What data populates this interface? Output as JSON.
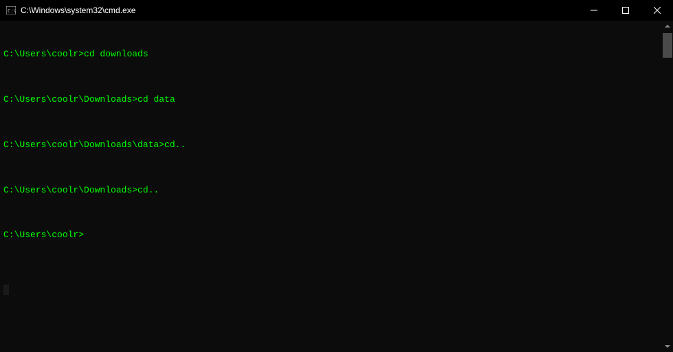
{
  "titlebar": {
    "title": "C:\\Windows\\system32\\cmd.exe"
  },
  "terminal": {
    "lines": [
      {
        "prompt": "C:\\Users\\coolr>",
        "command": "cd downloads"
      },
      {
        "prompt": "C:\\Users\\coolr\\Downloads>",
        "command": "cd data"
      },
      {
        "prompt": "C:\\Users\\coolr\\Downloads\\data>",
        "command": "cd.."
      },
      {
        "prompt": "C:\\Users\\coolr\\Downloads>",
        "command": "cd.."
      },
      {
        "prompt": "C:\\Users\\coolr>",
        "command": ""
      }
    ]
  },
  "colors": {
    "text": "#00ff00",
    "background": "#0c0c0c"
  }
}
